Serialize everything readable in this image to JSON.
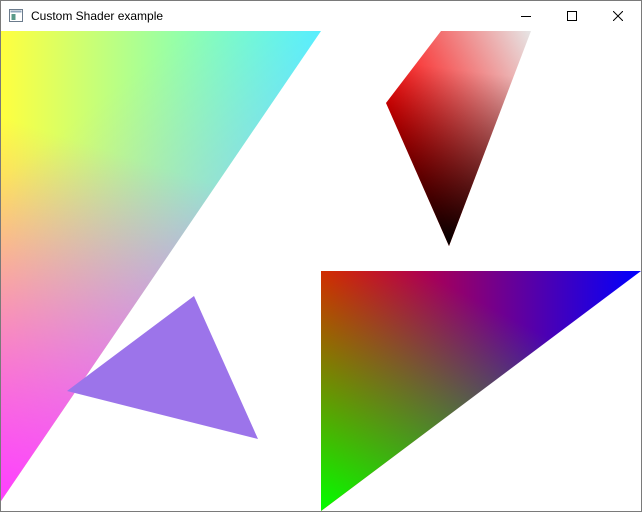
{
  "window": {
    "title": "Custom Shader example",
    "icon": "app-window-icon",
    "controls": {
      "minimize_icon": "minimize-icon",
      "maximize_icon": "maximize-icon",
      "close_icon": "close-icon"
    }
  },
  "scene": {
    "background": "#ffffff",
    "shapes": [
      {
        "name": "rainbow-triangle-left",
        "colors": [
          "#ffff3f",
          "#3fffff",
          "#ff3fff"
        ]
      },
      {
        "name": "red-gray-triangle",
        "colors": [
          "#ff0000",
          "#e0e0e0",
          "#000000"
        ]
      },
      {
        "name": "purple-triangle",
        "colors": [
          "#9c74ea"
        ]
      },
      {
        "name": "rgb-triangle-right",
        "colors": [
          "#ff0000",
          "#0000ff",
          "#00ff00"
        ]
      }
    ]
  }
}
